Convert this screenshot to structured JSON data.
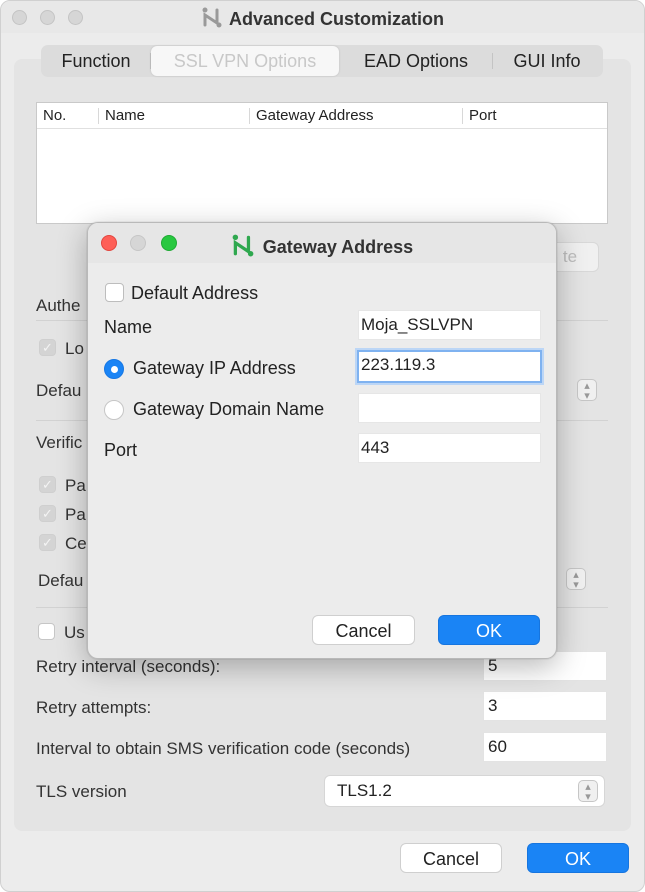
{
  "window": {
    "title": "Advanced Customization",
    "tabs": [
      "Function",
      "SSL VPN Options",
      "EAD Options",
      "GUI Info"
    ],
    "active_tab": "SSL VPN Options"
  },
  "table": {
    "columns": [
      "No.",
      "Name",
      "Gateway Address",
      "Port"
    ],
    "rows": []
  },
  "background": {
    "delete_button_fragment": "te",
    "auth_heading_fragment": "Authe",
    "login_check_fragment": "Lo",
    "default_fragment_1": "Defau",
    "verification_heading_fragment": "Verific",
    "check_fragment_1": "Pa",
    "check_fragment_2": "Pa",
    "check_fragment_3": "Ce",
    "default_fragment_2": "Defau",
    "use_check_fragment": "Us",
    "retry_interval_label": "Retry interval (seconds):",
    "retry_interval_value": "5",
    "retry_attempts_label": "Retry attempts:",
    "retry_attempts_value": "3",
    "sms_interval_label": "Interval to obtain SMS verification code (seconds)",
    "sms_interval_value": "60",
    "tls_label": "TLS version",
    "tls_value": "TLS1.2",
    "cancel_label": "Cancel",
    "ok_label": "OK"
  },
  "dialog": {
    "title": "Gateway Address",
    "default_address_label": "Default Address",
    "default_address_checked": false,
    "name_label": "Name",
    "name_value": "Moja_SSLVPN",
    "gateway_ip_label": "Gateway IP Address",
    "gateway_ip_value": "223.119.3",
    "gateway_domain_label": "Gateway Domain Name",
    "gateway_domain_value": "",
    "selected_mode": "Gateway IP Address",
    "port_label": "Port",
    "port_value": "443",
    "cancel_label": "Cancel",
    "ok_label": "OK"
  },
  "colors": {
    "accent": "#1a84f5",
    "close": "#fe5f57",
    "minimize": "#d6d6d6",
    "zoom": "#28c840",
    "app_icon": "#2fa84f"
  },
  "icons": {
    "app": "app-logo-icon",
    "stepper": "chevron-updown-icon",
    "checkbox": "checkmark-icon"
  }
}
